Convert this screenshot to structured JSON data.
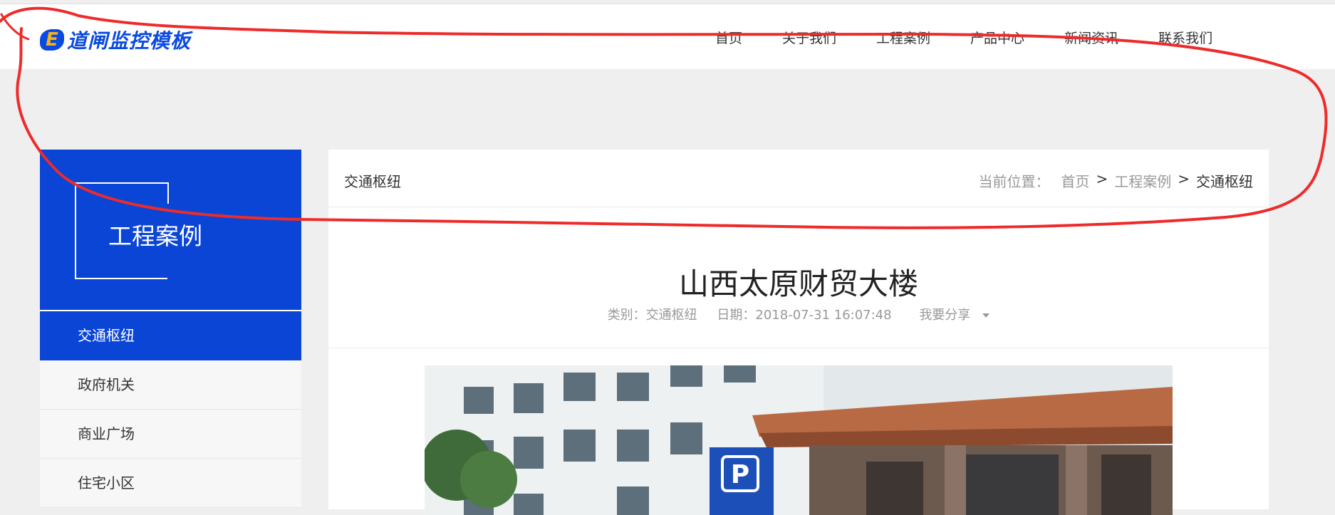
{
  "header": {
    "logo_letter": "E",
    "logo_text": "道闸监控模板",
    "nav": [
      "首页",
      "关于我们",
      "工程案例",
      "产品中心",
      "新闻资讯",
      "联系我们"
    ]
  },
  "sidebar": {
    "title": "工程案例",
    "items": [
      "交通枢纽",
      "政府机关",
      "商业广场",
      "住宅小区"
    ],
    "active_index": 0
  },
  "content": {
    "category": "交通枢纽",
    "breadcrumb": {
      "label": "当前位置：",
      "links": [
        "首页",
        "工程案例"
      ],
      "separator": ">",
      "current": "交通枢纽"
    },
    "article": {
      "title": "山西太原财贸大楼",
      "meta_category": "类别：交通枢纽",
      "meta_date": "日期：2018-07-31 16:07:48",
      "share": "我要分享"
    },
    "photo_sign_letter": "P"
  },
  "colors": {
    "brand_blue": "#0a45d6",
    "annotation_red": "#ee2b2b"
  }
}
